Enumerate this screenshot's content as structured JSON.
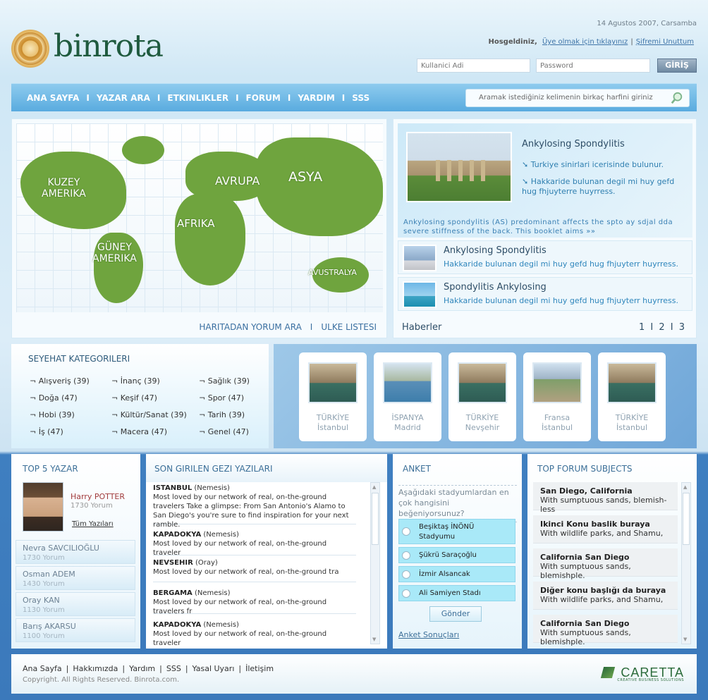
{
  "header": {
    "logo_text": "binrota",
    "date": "14 Agustos 2007, Carsamba",
    "welcome": "Hosgeldiniz,",
    "register_link": "Üye olmak için tıklayınız",
    "forgot_link": "Şifremi Unuttum",
    "link_separator": "|",
    "username_placeholder": "Kullanici Adi",
    "password_placeholder": "Password",
    "login_button": "GİRİŞ"
  },
  "nav": {
    "items": [
      "ANA SAYFA",
      "YAZAR ARA",
      "ETKINLIKLER",
      "FORUM",
      "YARDIM",
      "SSS"
    ],
    "separator": "I",
    "search_placeholder": "Aramak istediğiniz kelimenin birkaç harfini giriniz"
  },
  "map": {
    "labels": {
      "north_america": "KUZEY\nAMERIKA",
      "south_america": "GÜNEY\nAMERIKA",
      "europe": "AVRUPA",
      "asia": "ASYA",
      "africa": "AFRIKA",
      "australia": "AVUSTRALYA"
    },
    "link_search": "HARITADAN YORUM ARA",
    "link_separator": "I",
    "link_countries": "ULKE LISTESI"
  },
  "news": {
    "featured": {
      "title": "Ankylosing Spondylitis",
      "bullet1": "Turkiye sinirlari icerisinde bulunur.",
      "bullet2": "Hakkaride bulunan degil mi huy gefd hug fhjuyterre  huyrress.",
      "desc": "Ankylosing spondylitis (AS) predominant affects the spto ay sdjal dda severe stiffness of  the back. This booklet aims »»"
    },
    "items": [
      {
        "title": "Ankylosing Spondylitis",
        "desc": "Hakkaride bulunan degil mi huy gefd  hug fhjuyterr huyrress."
      },
      {
        "title": "Spondylitis Ankylosing",
        "desc": "Hakkaride bulunan degil mi huy gefd  hug fhjuyterr huyrress."
      }
    ],
    "footer_label": "Haberler",
    "pages": "1 I 2 I 3"
  },
  "categories": {
    "title": "SEYEHAT KATEGORILERI",
    "items": [
      "¬ Alışveriş  (39)",
      "¬ İnanç (39)",
      "¬ Sağlık (39)",
      "¬ Doğa (47)",
      "¬ Keşif (47)",
      "¬ Spor (47)",
      "¬ Hobi (39)",
      "¬ Kültür/Sanat (39)",
      "¬ Tarih (39)",
      "¬ İş (47)",
      "¬ Macera (47)",
      "¬ Genel (47)"
    ]
  },
  "destinations": [
    {
      "country": "TÜRKİYE",
      "city": "İstanbul"
    },
    {
      "country": "İSPANYA",
      "city": "Madrid"
    },
    {
      "country": "TÜRKİYE",
      "city": "Nevşehir"
    },
    {
      "country": "Fransa",
      "city": "İstanbul"
    },
    {
      "country": "TÜRKİYE",
      "city": "İstanbul"
    }
  ],
  "top_writers": {
    "title": "TOP 5 YAZAR",
    "featured": {
      "name": "Harry POTTER",
      "count": "1730 Yorum",
      "all_link": "Tüm Yazıları"
    },
    "list": [
      {
        "name": "Nevra SAVCILIOĞLU",
        "count": "1730 Yorum"
      },
      {
        "name": "Osman ADEM",
        "count": "1430 Yorum"
      },
      {
        "name": "Oray KAN",
        "count": "1130 Yorum"
      },
      {
        "name": "Barış AKARSU",
        "count": "1100 Yorum"
      }
    ]
  },
  "posts": {
    "title": "SON GIRILEN GEZI YAZILARI",
    "items": [
      {
        "place": "ISTANBUL",
        "author": "(Nemesis)",
        "text": "Most loved by our network of real, on-the-ground travelers Take a glimpse: From San Antonio's Alamo to San Diego's you're sure to find inspiration for your next ramble."
      },
      {
        "place": "KAPADOKYA",
        "author": "(Nemesis)",
        "text": "Most loved by our network of real, on-the-ground traveler"
      },
      {
        "place": "NEVSEHIR",
        "author": "(Oray)",
        "text": "Most loved by our network of real, on-the-ground tra"
      },
      {
        "place": "BERGAMA",
        "author": "(Nemesis)",
        "text": "Most loved by our network of real, on-the-ground travelers fr"
      },
      {
        "place": "KAPADOKYA",
        "author": "(Nemesis)",
        "text": "Most loved by our network of real, on-the-ground traveler"
      }
    ]
  },
  "poll": {
    "title": "ANKET",
    "question": "Aşağıdaki stadyumlardan en çok hangisini beğeniyorsunuz?",
    "options": [
      "Beşiktaş İNÖNÜ Stadyumu",
      "Şükrü Saraçoğlu",
      "İzmir Alsancak",
      "Ali Samiyen Stadı"
    ],
    "submit": "Gönder",
    "results_link": "Anket Sonuçları"
  },
  "forum": {
    "title": "TOP FORUM SUBJECTS",
    "items": [
      {
        "title": "San Diego, California",
        "desc": "With sumptuous sands, blemish-less"
      },
      {
        "title": "Ikinci Konu baslik buraya",
        "desc": "With wildlife parks, and Shamu,"
      },
      {
        "title": "California San Diego",
        "desc": "With sumptuous sands, blemishple."
      },
      {
        "title": "Diğer konu başlığı da buraya",
        "desc": "With wildlife parks, and Shamu,"
      },
      {
        "title": "California San Diego",
        "desc": "With sumptuous sands, blemishple."
      }
    ]
  },
  "footer": {
    "links": [
      "Ana Sayfa",
      "Hakkımızda",
      "Yardım",
      "SSS",
      "Yasal Uyarı",
      "İletişim"
    ],
    "separator": "|",
    "copyright": "Copyright. All Rights Reserved. Binrota.com.",
    "brand": "CARETTA",
    "brand_sub": "CREATIVE BUSINESS SOLUTIONS"
  },
  "icons": {
    "search": "search-icon",
    "bullet": "arrow-bullet-icon",
    "scroll_up": "scroll-up-icon",
    "scroll_down": "scroll-down-icon",
    "brand_mark": "caretta-logo-icon"
  },
  "colors": {
    "nav_bg": "#59abdf",
    "logo_green": "#1f5a3e",
    "map_green": "#6fa43e",
    "poll_option": "#a9e9f8"
  }
}
